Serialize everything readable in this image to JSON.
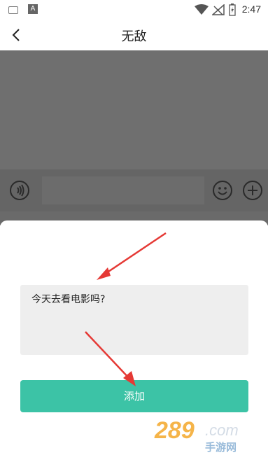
{
  "status_bar": {
    "left_icons": [
      "keyboard-icon",
      "font-a-icon"
    ],
    "font_badge": "A",
    "time": "2:47"
  },
  "header": {
    "title": "无敌"
  },
  "dialog": {
    "message_text": "今天去看电影吗?",
    "add_button_label": "添加"
  },
  "watermark": {
    "brand": "289.com",
    "tagline": "手游网"
  },
  "colors": {
    "accent": "#3cc3a6",
    "overlay": "#6f6f6f",
    "arrow": "#e53935"
  }
}
